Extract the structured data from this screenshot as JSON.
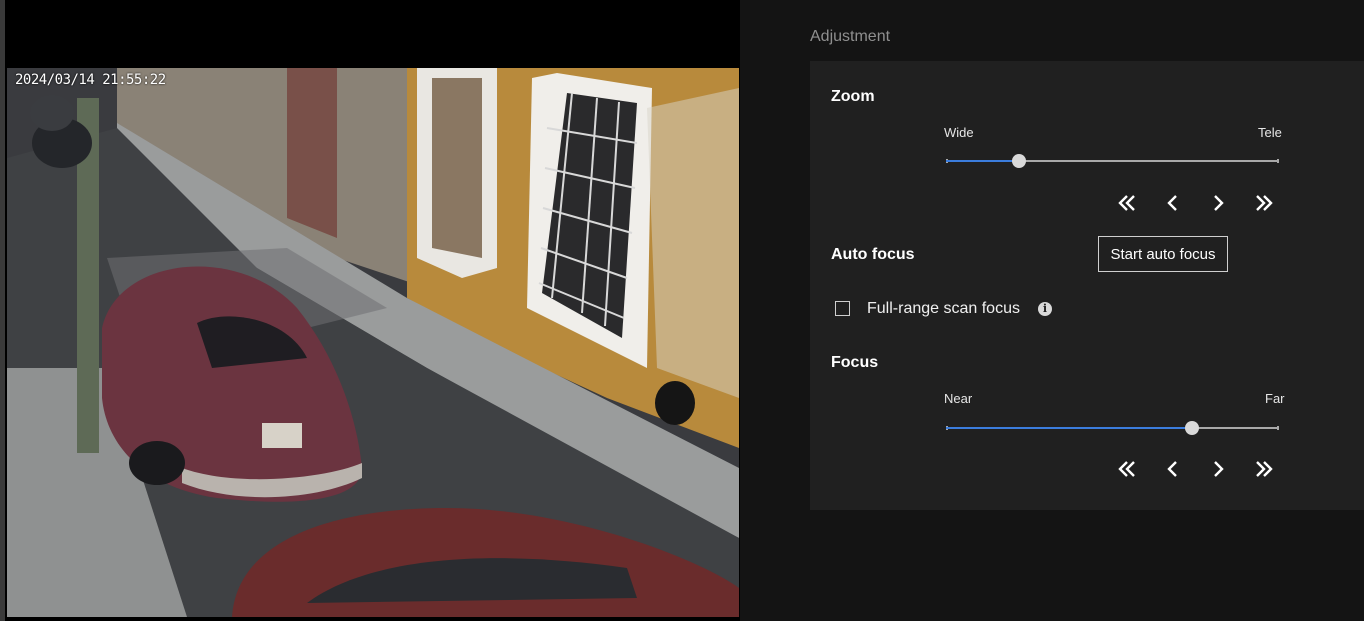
{
  "camera": {
    "timestamp": "2024/03/14 21:55:22"
  },
  "adjustment": {
    "section_label": "Adjustment",
    "zoom": {
      "title": "Zoom",
      "min_label": "Wide",
      "max_label": "Tele",
      "value_fraction": 0.22,
      "buttons": [
        "double-chevron-left-icon",
        "chevron-left-icon",
        "chevron-right-icon",
        "double-chevron-right-icon"
      ]
    },
    "auto_focus": {
      "title": "Auto focus",
      "button_label": "Start auto focus",
      "full_range_label": "Full-range scan focus",
      "full_range_checked": false,
      "info_glyph": "i"
    },
    "focus": {
      "title": "Focus",
      "min_label": "Near",
      "max_label": "Far",
      "value_fraction": 0.74,
      "buttons": [
        "double-chevron-left-icon",
        "chevron-left-icon",
        "chevron-right-icon",
        "double-chevron-right-icon"
      ]
    },
    "colors": {
      "accent": "#3b7ddd",
      "panel": "#202020",
      "background": "#141414"
    }
  }
}
